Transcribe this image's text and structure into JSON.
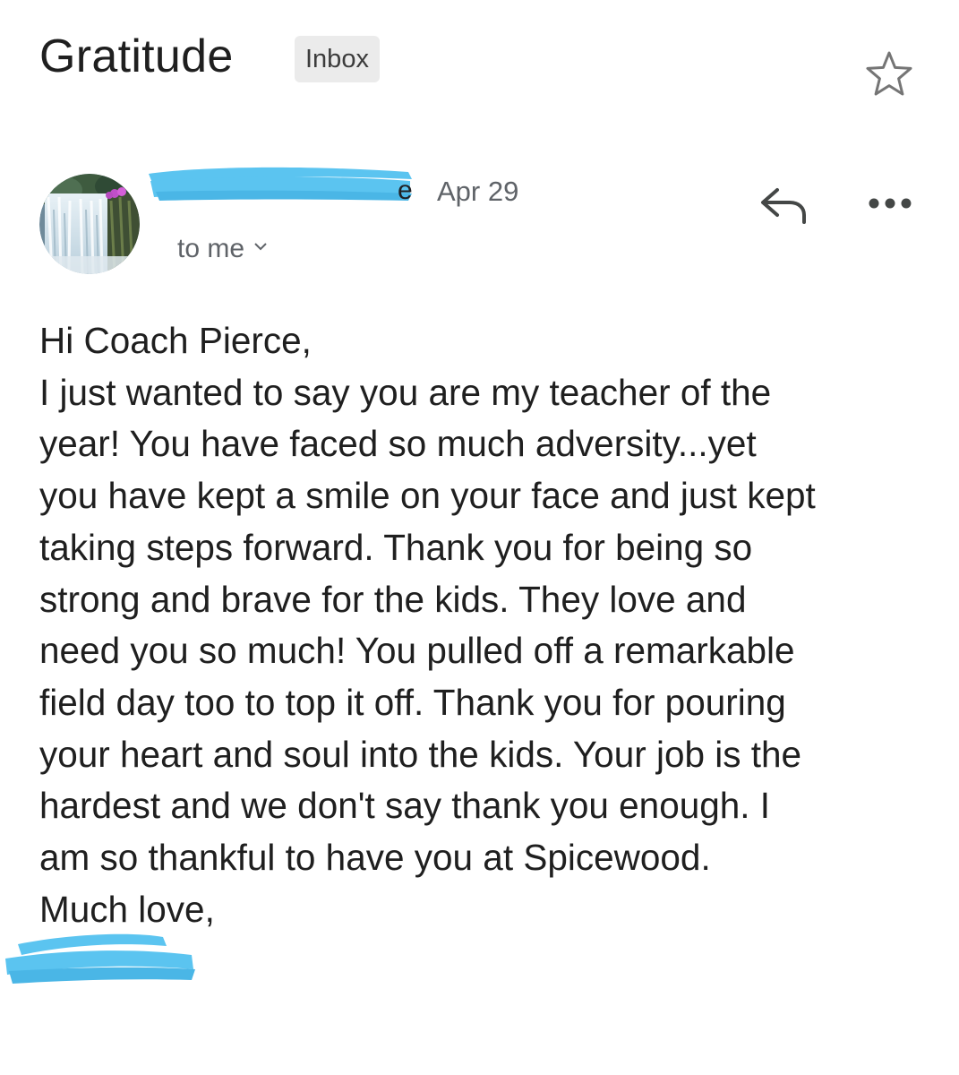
{
  "email": {
    "subject": "Gratitude",
    "label": "Inbox",
    "date": "Apr 29",
    "recipient": "to me",
    "body_lines": [
      "Hi Coach Pierce,",
      "I just wanted to say you are my teacher of the",
      "year!  You have faced so much adversity...yet",
      "you have kept a smile on your face and just kept",
      "taking steps forward.  Thank you for being so",
      "strong and brave for the kids.  They love and",
      "need you so much!  You pulled off a remarkable",
      "field day too to top it off.  Thank you for pouring",
      "your heart and soul into the kids.  Your job is the",
      "hardest and we don't say thank you enough.  I",
      "am so thankful to have you at Spicewood.",
      "Much love,"
    ]
  },
  "icons": {
    "star": "star-outline-icon",
    "reply": "reply-icon",
    "more": "more-horizontal-icon",
    "expand": "chevron-down-icon"
  },
  "colors": {
    "redaction": "#5bc4f0",
    "chip_bg": "#ebebeb",
    "secondary_text": "#5f6368"
  }
}
